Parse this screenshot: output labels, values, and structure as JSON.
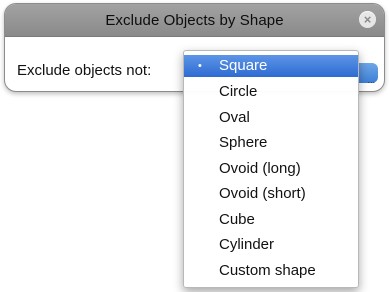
{
  "dialog": {
    "title": "Exclude Objects by Shape",
    "close_glyph": "×",
    "label": "Exclude objects not:",
    "popup_ellipsis": "..."
  },
  "menu": {
    "selected_marker": "•",
    "items": [
      {
        "label": "Square",
        "selected": true
      },
      {
        "label": "Circle",
        "selected": false
      },
      {
        "label": "Oval",
        "selected": false
      },
      {
        "label": "Sphere",
        "selected": false
      },
      {
        "label": "Ovoid (long)",
        "selected": false
      },
      {
        "label": "Ovoid (short)",
        "selected": false
      },
      {
        "label": "Cube",
        "selected": false
      },
      {
        "label": "Cylinder",
        "selected": false
      },
      {
        "label": "Custom shape",
        "selected": false
      }
    ]
  },
  "colors": {
    "titlebar": "#8f8f8f",
    "selection": "#3b78d8"
  }
}
